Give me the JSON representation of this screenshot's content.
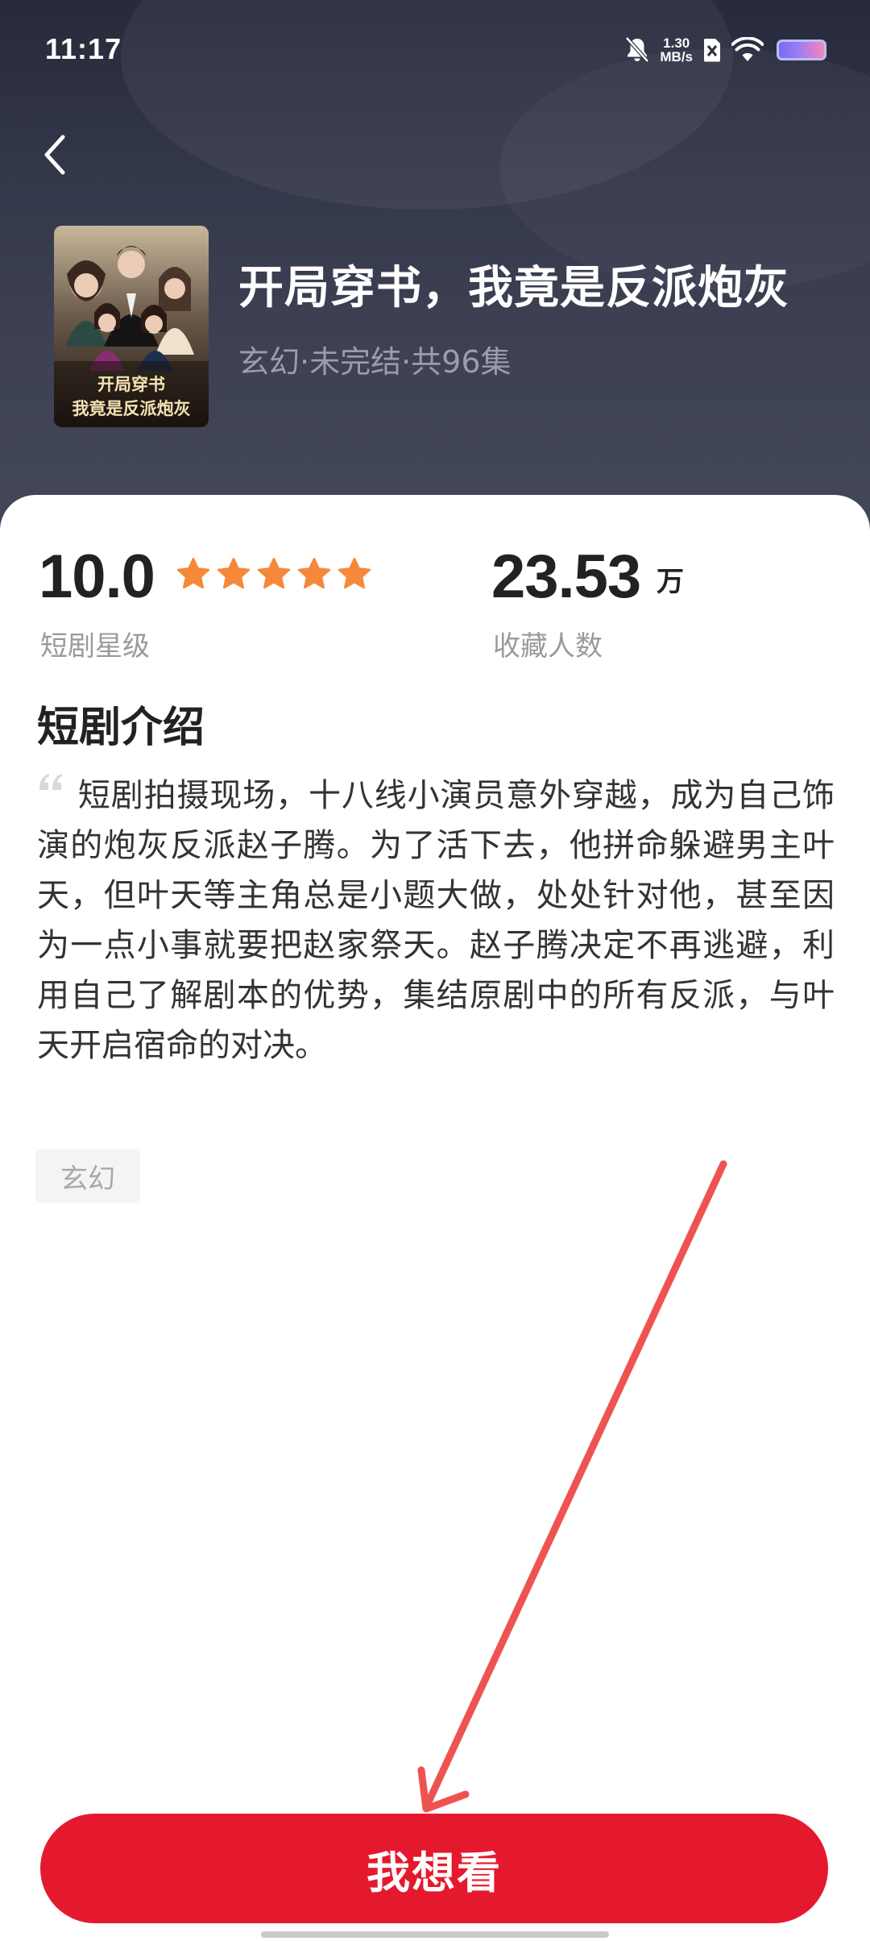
{
  "status_bar": {
    "time": "11:17",
    "net_speed_value": "1.30",
    "net_speed_unit": "MB/s",
    "icons": [
      "bell-muted-icon",
      "sim-disabled-icon",
      "wifi-icon",
      "battery-icon"
    ]
  },
  "header": {
    "back_icon": "chevron-left-icon",
    "poster_text_line1": "开局穿书",
    "poster_text_line2": "我竟是反派炮灰",
    "title": "开局穿书，我竟是反派炮灰",
    "meta": "玄幻·未完结·共96集"
  },
  "stats": {
    "rating_value": "10.0",
    "rating_stars": 5,
    "rating_label": "短剧星级",
    "favorites_value": "23.53",
    "favorites_unit": "万",
    "favorites_label": "收藏人数"
  },
  "intro": {
    "section_title": "短剧介绍",
    "text": "短剧拍摄现场，十八线小演员意外穿越，成为自己饰演的炮灰反派赵子腾。为了活下去，他拼命躲避男主叶天，但叶天等主角总是小题大做，处处针对他，甚至因为一点小事就要把赵家祭天。赵子腾决定不再逃避，利用自己了解剧本的优势，集结原剧中的所有反派，与叶天开启宿命的对决。",
    "tags": [
      "玄幻"
    ]
  },
  "cta": {
    "label": "我想看"
  },
  "colors": {
    "accent": "#e5192e",
    "star": "#f5883a",
    "header_bg": "#34384b"
  }
}
